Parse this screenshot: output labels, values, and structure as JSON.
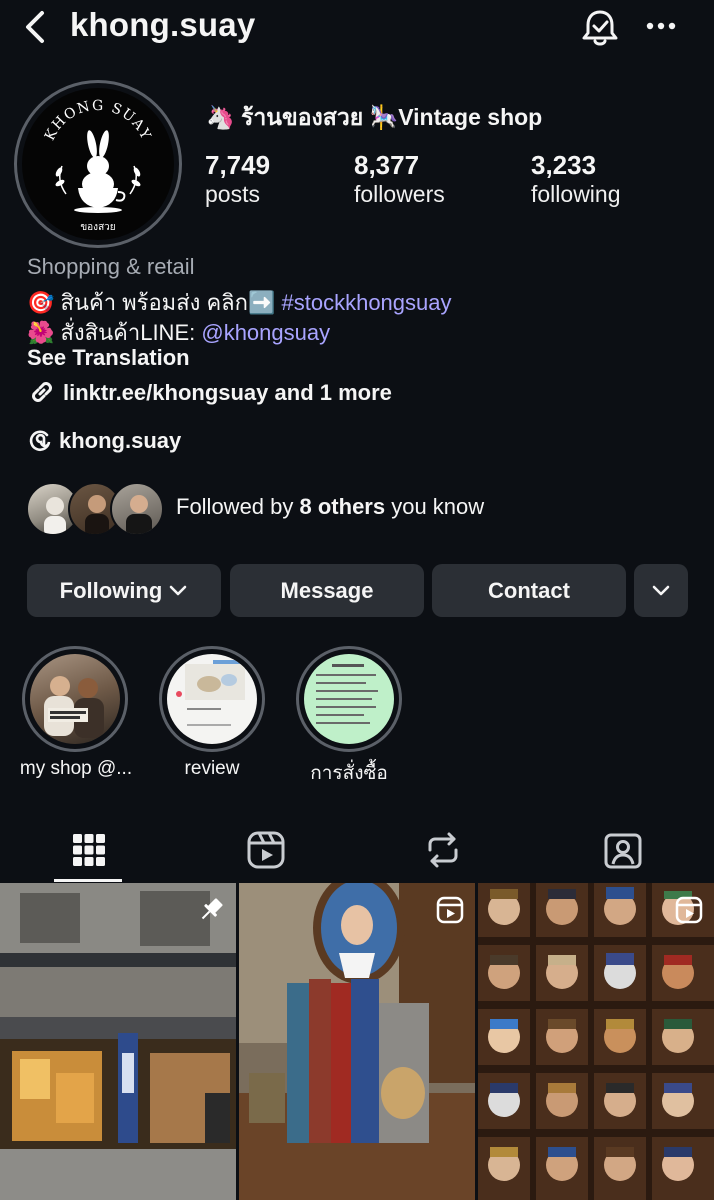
{
  "header": {
    "username": "khong.suay"
  },
  "profile": {
    "avatar_texts": [
      "KHONG SUAY",
      "ของสวย"
    ],
    "display_name": "🦄 ร้านของสวย 🎠Vintage shop",
    "stats": [
      {
        "value": "7,749",
        "label": "posts"
      },
      {
        "value": "8,377",
        "label": "followers"
      },
      {
        "value": "3,233",
        "label": "following"
      }
    ],
    "category": "Shopping & retail",
    "bio_line1_prefix": "🎯 สินค้า พร้อมส่ง คลิก➡️ ",
    "bio_line1_tag": "#stockkhongsuay",
    "bio_line2_prefix": "🌺 สั่งสินค้าLINE: ",
    "bio_line2_handle": "@khongsuay",
    "see_translation": "See Translation",
    "link": "linktr.ee/khongsuay and 1 more",
    "threads": "khong.suay"
  },
  "followed_by": {
    "prefix": "Followed by ",
    "bold": "8 others",
    "suffix": " you know"
  },
  "buttons": {
    "following": "Following",
    "message": "Message",
    "contact": "Contact"
  },
  "highlights": [
    {
      "label": "my shop @..."
    },
    {
      "label": "review"
    },
    {
      "label": "การสั่งซื้อ"
    }
  ],
  "tabs": [
    {
      "icon": "grid-icon",
      "active": true
    },
    {
      "icon": "reels-icon",
      "active": false
    },
    {
      "icon": "reposts-icon",
      "active": false
    },
    {
      "icon": "tagged-icon",
      "active": false
    }
  ],
  "colors": {
    "background": "#0c0f14",
    "button": "#2b2f35",
    "link": "#a9a4ff",
    "muted": "#a6abb3"
  }
}
